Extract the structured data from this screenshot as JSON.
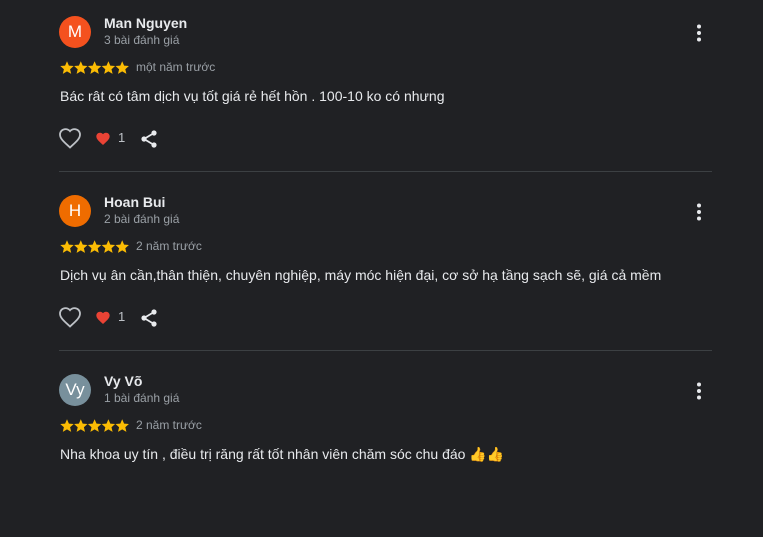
{
  "colors": {
    "background": "#202124",
    "star": "#fbbc04",
    "heart": "#ea4335",
    "divider": "#3c4043"
  },
  "icons": {
    "menu": "more-vert-icon",
    "like": "heart-outline-icon",
    "reaction": "heart-filled-icon",
    "share": "share-icon"
  },
  "reviews": [
    {
      "avatar_letter": "M",
      "avatar_color": "#f4511e",
      "name": "Man Nguyen",
      "review_count": "3 bài đánh giá",
      "rating": 5,
      "time": "một năm trước",
      "text": "Bác rât có tâm dịch vụ tốt giá rẻ hết hồn . 100-10 ko có nhưng",
      "reactions": "1"
    },
    {
      "avatar_letter": "H",
      "avatar_color": "#ef6c00",
      "name": "Hoan Bui",
      "review_count": "2 bài đánh giá",
      "rating": 5,
      "time": "2 năm trước",
      "text": "Dịch vụ ân cần,thân thiện, chuyên nghiệp, máy móc hiện đại, cơ sở hạ tầng sạch sẽ, giá cả mềm",
      "reactions": "1"
    },
    {
      "avatar_letter": "Vy",
      "avatar_color": "#78909c",
      "name": "Vy Võ",
      "review_count": "1 bài đánh giá",
      "rating": 5,
      "time": "2 năm trước",
      "text": "Nha khoa uy tín , điều trị răng rất tốt nhân viên chăm sóc chu đáo 👍👍"
    }
  ]
}
